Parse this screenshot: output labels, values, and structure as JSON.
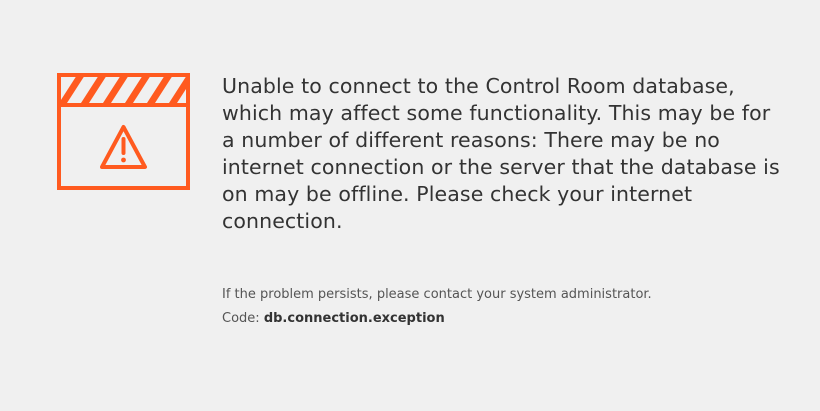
{
  "error": {
    "icon": "clapperboard-warning-icon",
    "accent_color": "#ff5a1f",
    "message": "Unable to connect to the Control Room database, which may affect some functionality. This may be for a number of different reasons: There may be no internet connection or the server that the database is on may be offline. Please check your internet connection.",
    "hint": "If the problem persists, please contact your system administrator.",
    "code_label": "Code:",
    "code_value": "db.connection.exception"
  }
}
